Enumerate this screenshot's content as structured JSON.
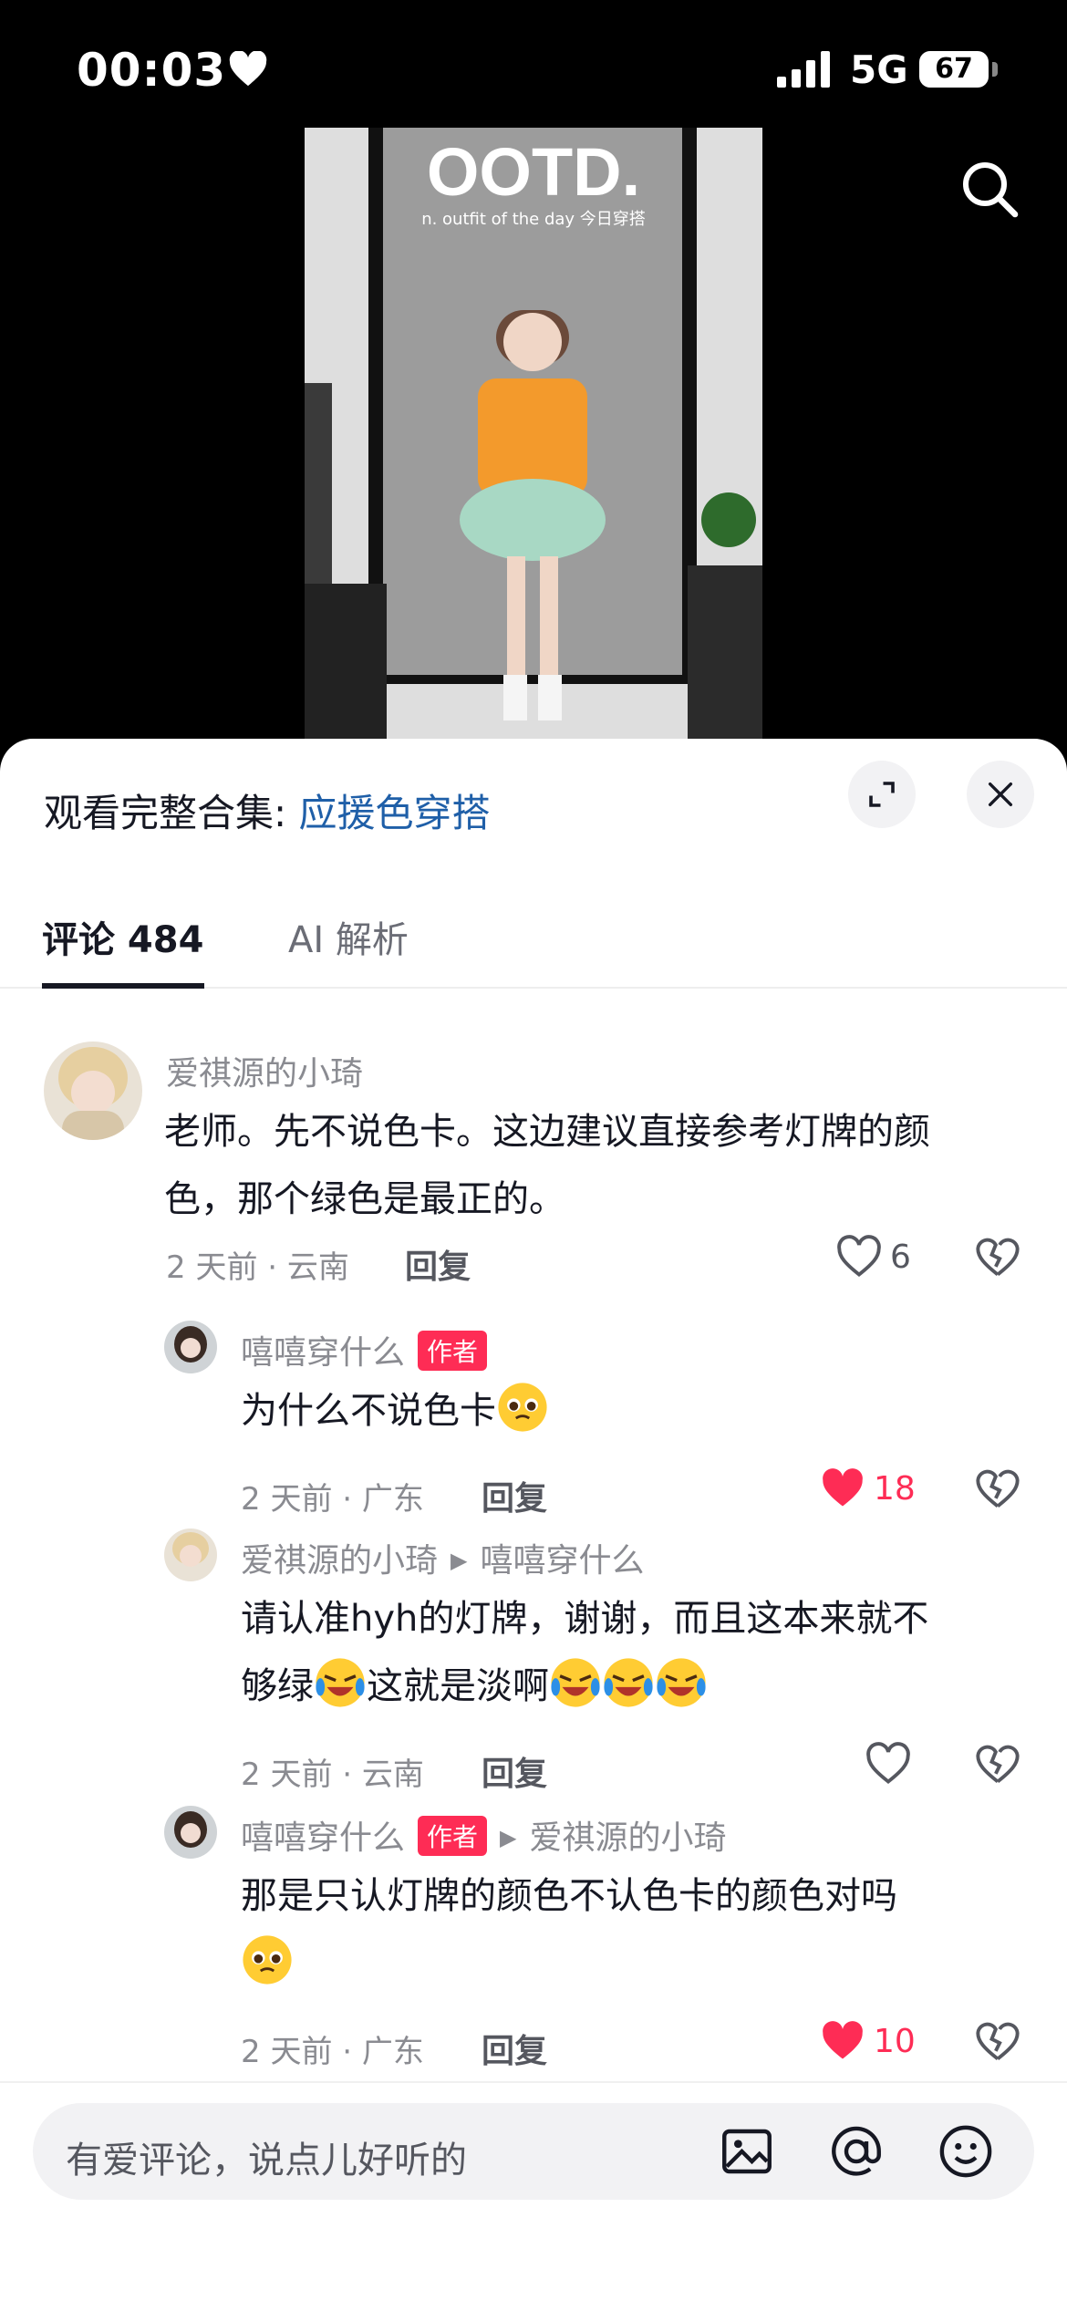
{
  "status_bar": {
    "time": "00:03",
    "network": "5G",
    "battery": "67"
  },
  "video": {
    "title": "OOTD.",
    "subtitle": "n. outfit of the day 今日穿搭"
  },
  "sheet": {
    "collection_prefix": "观看完整合集:",
    "collection_name": "应援色穿搭",
    "tabs": [
      {
        "label": "评论 484",
        "active": true
      },
      {
        "label": "AI 解析",
        "active": false
      }
    ]
  },
  "comments": [
    {
      "user": "爱祺源的小琦",
      "text_lines": [
        "老师。先不说色卡。这边建议直接参考灯牌的颜",
        "色，那个绿色是最正的。"
      ],
      "meta": "2 天前 · 云南",
      "reply_label": "回复",
      "likes": "6",
      "liked": false
    },
    {
      "user": "嘻嘻穿什么",
      "author_tag": "作者",
      "text": "为什么不说色卡",
      "meta": "2 天前 · 广东",
      "reply_label": "回复",
      "likes": "18",
      "liked": true
    },
    {
      "user": "爱祺源的小琦",
      "reply_to": "嘻嘻穿什么",
      "text_line1": "请认准hyh的灯牌，谢谢，而且这本来就不",
      "text_line2_a": "够绿",
      "text_line2_b": "这就是淡啊",
      "meta": "2 天前 · 云南",
      "reply_label": "回复",
      "likes": "",
      "liked": false
    },
    {
      "user": "嘻嘻穿什么",
      "author_tag": "作者",
      "reply_to": "爱祺源的小琦",
      "text_line1": "那是只认灯牌的颜色不认色卡的颜色对吗",
      "meta": "2 天前 · 广东",
      "reply_label": "回复",
      "likes": "10",
      "liked": true
    }
  ],
  "input": {
    "placeholder": "有爱评论，说点儿好听的"
  },
  "colors": {
    "accent_red": "#fe2c55",
    "link_blue": "#1f5fa8",
    "text": "#161823",
    "muted": "#8a8b91"
  }
}
